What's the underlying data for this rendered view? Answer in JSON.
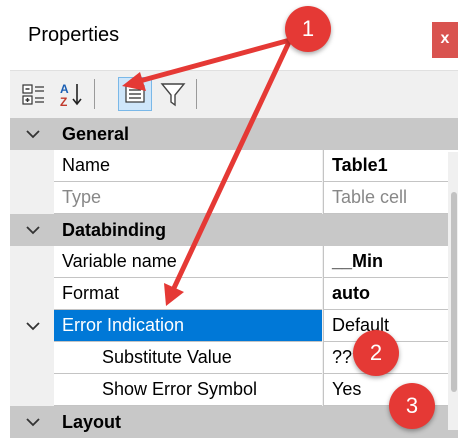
{
  "panel": {
    "title": "Properties",
    "close_label": "x"
  },
  "toolbar": {
    "buttons": [
      {
        "icon": "categorized-view-icon"
      },
      {
        "icon": "sort-alphabetical-icon",
        "label": "A Z"
      },
      {
        "icon": "properties-page-icon",
        "active": true
      },
      {
        "icon": "filter-icon"
      }
    ]
  },
  "grid": {
    "categories": {
      "general": "General",
      "databinding": "Databinding",
      "layout": "Layout"
    },
    "rows": {
      "name": {
        "label": "Name",
        "value": "Table1"
      },
      "type": {
        "label": "Type",
        "value": "Table cell"
      },
      "variable_name": {
        "label": "Variable name",
        "value": "__Min"
      },
      "format": {
        "label": "Format",
        "value": "auto"
      },
      "error_indication": {
        "label": "Error Indication",
        "value": "Default"
      },
      "substitute_value": {
        "label": "Substitute Value",
        "value": "???"
      },
      "show_error_symbol": {
        "label": "Show Error Symbol",
        "value": "Yes"
      }
    }
  },
  "annotations": {
    "badge_1": "1",
    "badge_2": "2",
    "badge_3": "3",
    "color": "#e53935"
  }
}
